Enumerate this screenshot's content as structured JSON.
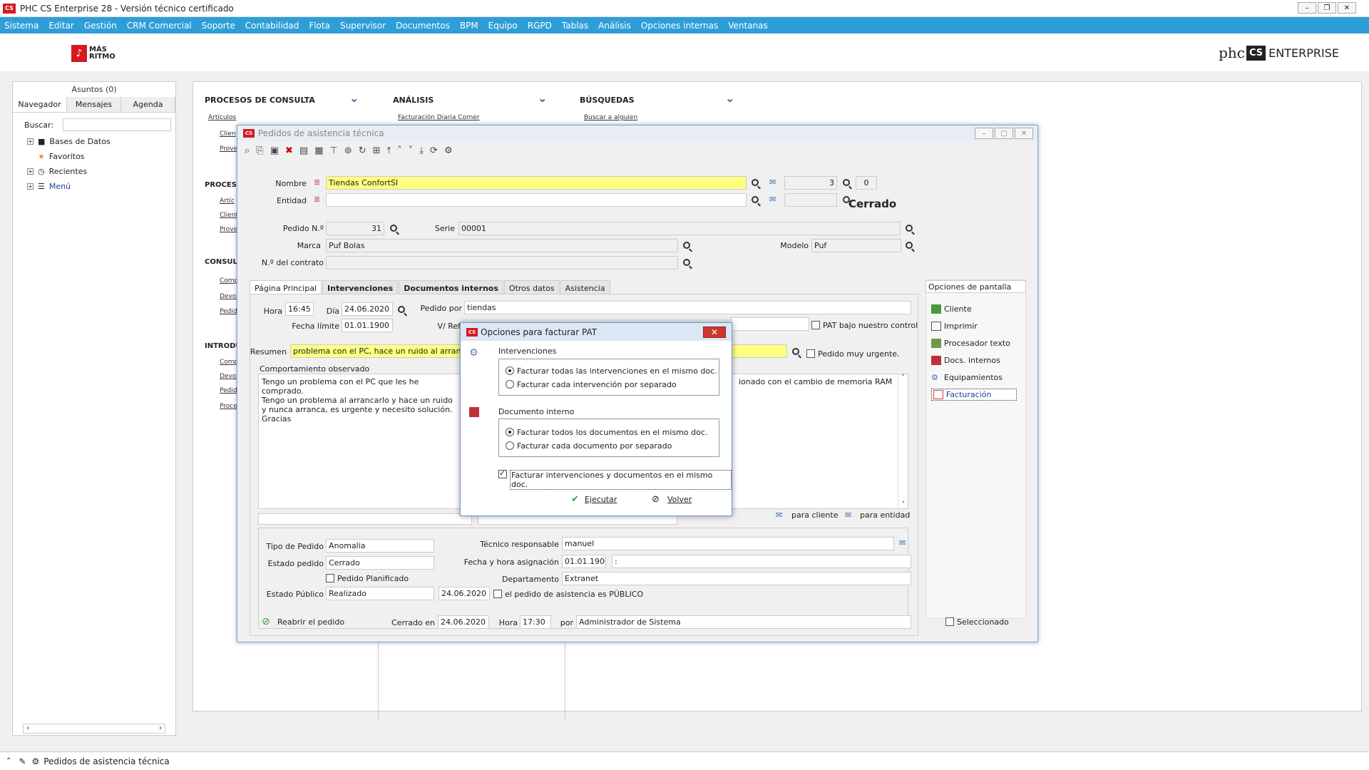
{
  "app": {
    "title": "PHC CS Enterprise 28 - Versión técnico certificado",
    "logo": "CS"
  },
  "menu": [
    "Sistema",
    "Editar",
    "Gestión",
    "CRM Comercial",
    "Soporte",
    "Contabilidad",
    "Flota",
    "Supervisor",
    "Documentos",
    "BPM",
    "Equipo",
    "RGPD",
    "Tablas",
    "Análisis",
    "Opciones internas",
    "Ventanas"
  ],
  "brand": {
    "name": "MÁS RITMO",
    "enterprise": "ENTERPRISE",
    "cs": "CS",
    "phc": "phc"
  },
  "left": {
    "asuntos": "Asuntos (0)",
    "tabs": [
      "Navegador",
      "Mensajes",
      "Agenda"
    ],
    "buscar": "Buscar:",
    "tree": [
      "Bases de Datos",
      "Favoritos",
      "Recientes",
      "Menú"
    ]
  },
  "main": {
    "sections": [
      "PROCESOS DE CONSULTA",
      "ANÁLISIS",
      "BÚSQUEDAS"
    ],
    "links": [
      "Artículos",
      "Facturación Diaria Corner",
      "Buscar a alguien"
    ],
    "left_labels": [
      "PROCES",
      "CONSUL",
      "INTRODU"
    ],
    "mini": [
      "Clien",
      "Prove",
      "Artíc",
      "Client",
      "Prove",
      "Comp",
      "Devol",
      "Pedid",
      "Comp",
      "Devol",
      "Pedid",
      "Proce"
    ]
  },
  "win": {
    "title": "Pedidos de asistencia técnica",
    "logo": "CS",
    "nombre_l": "Nombre",
    "nombre": "Tiendas ConfortSI",
    "num1": "3",
    "num2": "0",
    "entidad_l": "Entidad",
    "cerrado": "Cerrado",
    "pedido_l": "Pedido N.º",
    "pedido": "31",
    "serie_l": "Serie",
    "serie": "00001",
    "marca_l": "Marca",
    "marca": "Puf Bolas",
    "modelo_l": "Modelo",
    "modelo": "Puf",
    "contrato_l": "N.º del contrato",
    "tabs": [
      "Página Principal",
      "Intervenciones",
      "Documentos internos",
      "Otros datos",
      "Asistencia"
    ],
    "hora_l": "Hora",
    "hora": "16:45",
    "dia_l": "Día",
    "dia": "24.06.2020",
    "pedidopor_l": "Pedido por",
    "pedidopor": "tiendas",
    "flimite_l": "Fecha límite",
    "flimite": "01.01.1900",
    "vref_l": "V/ Ref",
    "pat_l": "PAT bajo nuestro control",
    "resumen_l": "Resumen",
    "resumen": "problema con el PC, hace un ruido al arrancar",
    "urgente_l": "Pedido muy urgente.",
    "comp_l": "Comportamiento observado",
    "comp": "Tengo un problema con el PC que les he comprado.\nTengo un problema al arrancarlo y hace un ruido y nunca arranca, es urgente y necesito solución.\nGracias",
    "comp2": "ionado con el cambio de memoria RAM",
    "para_cliente": "para cliente",
    "para_entidad": "para entidad",
    "tipo_l": "Tipo de Pedido",
    "tipo": "Anomalia",
    "tecnico_l": "Técnico responsable",
    "tecnico": "manuel",
    "estado_l": "Estado pedido",
    "estado": "Cerrado",
    "fasig_l": "Fecha y hora asignación",
    "fasig": "01.01.1900",
    "fasig_h": ":",
    "planif_l": "Pedido Planificado",
    "depto_l": "Departamento",
    "depto": "Extranet",
    "epub_l": "Estado Público",
    "epub": "Realizado",
    "epub_d": "24.06.2020",
    "publico_l": "el pedido de asistencia es PÚBLICO",
    "reabrir": "Reabrir el pedido",
    "cerradoen_l": "Cerrado en",
    "cerradoen": "24.06.2020",
    "hora2_l": "Hora",
    "hora2": "17:30",
    "por_l": "por",
    "por": "Administrador de Sistema",
    "opciones": "Opciones de pantalla",
    "right": [
      "Cliente",
      "Imprimir",
      "Procesador texto",
      "Docs. internos",
      "Equipamientos",
      "Facturación"
    ],
    "seleccionado": "Seleccionado"
  },
  "dialog": {
    "title": "Opciones para facturar PAT",
    "g1": "Intervenciones",
    "r1a": "Facturar todas las intervenciones en el mismo doc.",
    "r1b": "Facturar cada intervención por separado",
    "g2": "Documento interno",
    "r2a": "Facturar todos los documentos en el mismo doc.",
    "r2b": "Facturar cada documento por separado",
    "chk": "Facturar intervenciones y documentos en el mismo doc.",
    "ejecutar": "Ejecutar",
    "volver": "Volver"
  },
  "status": {
    "text": "Pedidos de asistencia técnica"
  }
}
